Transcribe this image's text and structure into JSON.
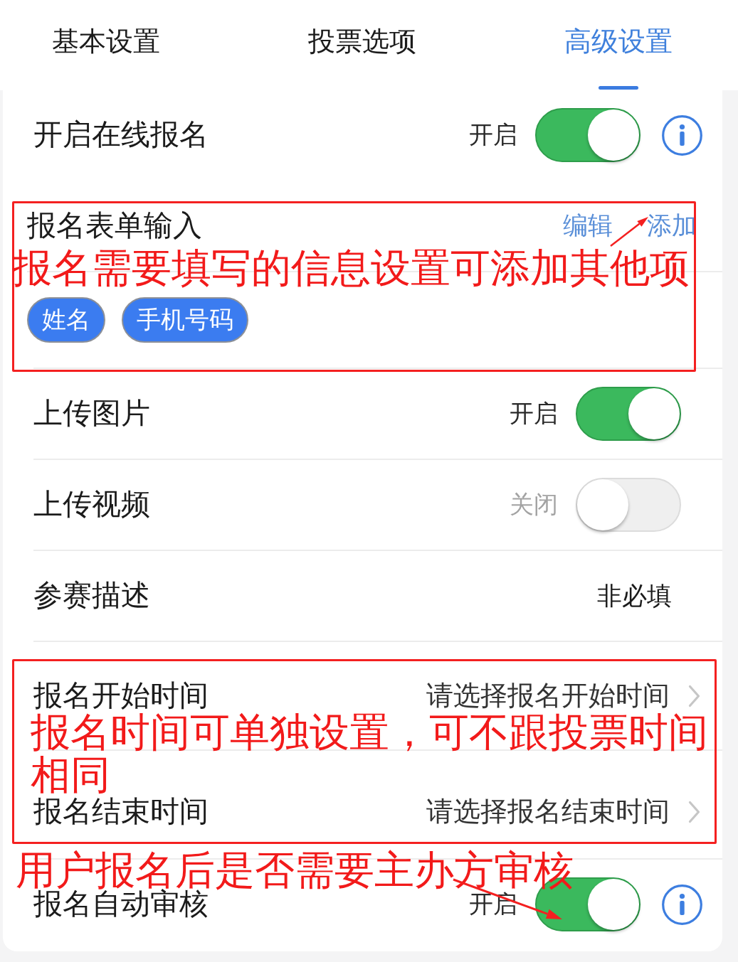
{
  "tabs": [
    {
      "label": "基本设置",
      "selected": false
    },
    {
      "label": "投票选项",
      "selected": false
    },
    {
      "label": "高级设置",
      "selected": true
    }
  ],
  "rows": [
    {
      "kind": "toggle",
      "label": "开启在线报名",
      "state_text": "开启",
      "on": true,
      "info": true
    },
    {
      "kind": "form",
      "label": "报名表单输入",
      "actions": [
        "编辑",
        "添加"
      ],
      "tags": [
        "姓名",
        "手机号码"
      ]
    },
    {
      "kind": "toggle",
      "label": "上传图片",
      "state_text": "开启",
      "on": true,
      "info": false
    },
    {
      "kind": "toggle",
      "label": "上传视频",
      "state_text": "关闭",
      "on": false,
      "info": false
    },
    {
      "kind": "value",
      "label": "参赛描述",
      "value": "非必填"
    },
    {
      "kind": "picker",
      "label": "报名开始时间",
      "placeholder": "请选择报名开始时间"
    },
    {
      "kind": "picker",
      "label": "报名结束时间",
      "placeholder": "请选择报名结束时间"
    },
    {
      "kind": "toggle",
      "label": "报名自动审核",
      "state_text": "开启",
      "on": true,
      "info": true
    }
  ],
  "annotations": [
    {
      "kind": "framed",
      "note": "报名需要填写的信息设置可添加其他项",
      "arrow": true
    },
    {
      "kind": "framed",
      "note": "报名时间可单独设置，可不跟投票时间相同",
      "arrow": false
    },
    {
      "kind": "plain",
      "note": "用户报名后是否需要主办方审核",
      "arrow": true
    }
  ]
}
